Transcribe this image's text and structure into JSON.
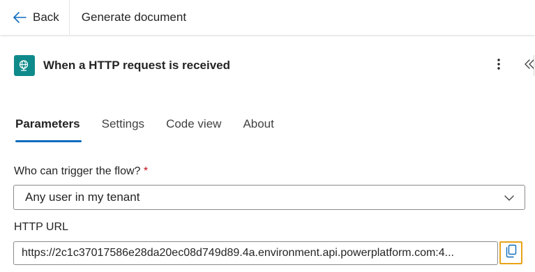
{
  "topbar": {
    "back_label": "Back",
    "title": "Generate document"
  },
  "trigger": {
    "title": "When a HTTP request is received",
    "icon": "globe-icon",
    "icon_bg": "#0f8a8a"
  },
  "tabs": [
    {
      "label": "Parameters",
      "active": true
    },
    {
      "label": "Settings",
      "active": false
    },
    {
      "label": "Code view",
      "active": false
    },
    {
      "label": "About",
      "active": false
    }
  ],
  "form": {
    "who_label": "Who can trigger the flow?",
    "required_marker": "*",
    "who_value": "Any user in my tenant",
    "url_label": "HTTP URL",
    "url_value": "https://2c1c37017586e28da20ec08d749d89.4a.environment.api.powerplatform.com:4..."
  },
  "colors": {
    "accent": "#0f6cbd",
    "copy_highlight": "#e8a317",
    "required": "#c50f1f"
  }
}
